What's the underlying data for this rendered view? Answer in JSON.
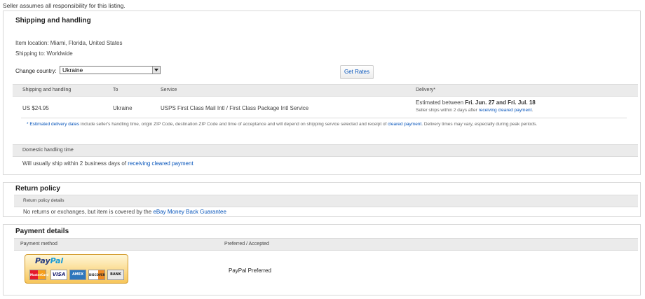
{
  "top_note": "Seller assumes all responsibility for this listing.",
  "shipping": {
    "title": "Shipping and handling",
    "item_location": "Item location: Miami, Florida, United States",
    "ships_to": "Shipping to: Worldwide",
    "change_country_label": "Change country:",
    "country_selected": "Ukraine",
    "get_rates_label": "Get Rates",
    "table_headers": {
      "shipping": "Shipping and handling",
      "to": "To",
      "service": "Service",
      "delivery": "Delivery*"
    },
    "row": {
      "price": "US $24.95",
      "to": "Ukraine",
      "service": "USPS First Class Mail Intl / First Class Package Intl Service",
      "delivery_prefix": "Estimated between ",
      "delivery_dates": "Fri. Jun. 27 and Fri. Jul. 18",
      "delivery_note_prefix": "Seller ships within 2 days after ",
      "delivery_note_link": "receiving cleared payment",
      "delivery_note_suffix": "."
    },
    "footnote": {
      "asterisk": "* ",
      "link1": "Estimated delivery dates",
      "text1": " include seller's handling time, origin ZIP Code, destination ZIP Code and time of acceptance and will depend on shipping service selected and receipt of ",
      "link2": "cleared payment",
      "text2": ". Delivery times may vary, especially during peak periods."
    },
    "handling_header": "Domestic handling time",
    "handling_text": "Will usually ship within 2 business days of ",
    "handling_link": "receiving cleared payment"
  },
  "returns": {
    "title": "Return policy",
    "details_header": "Return policy details",
    "text": "No returns or exchanges, but item is covered by the ",
    "link": "eBay Money Back Guarantee"
  },
  "payment": {
    "title": "Payment details",
    "col_method": "Payment method",
    "col_preferred": "Preferred / Accepted",
    "paypal_pay": "Pay",
    "paypal_pal": "Pal",
    "cards": [
      "MasterCard",
      "VISA",
      "AMEX",
      "DISCOVER",
      "BANK"
    ],
    "preferred_text": "PayPal Preferred"
  }
}
